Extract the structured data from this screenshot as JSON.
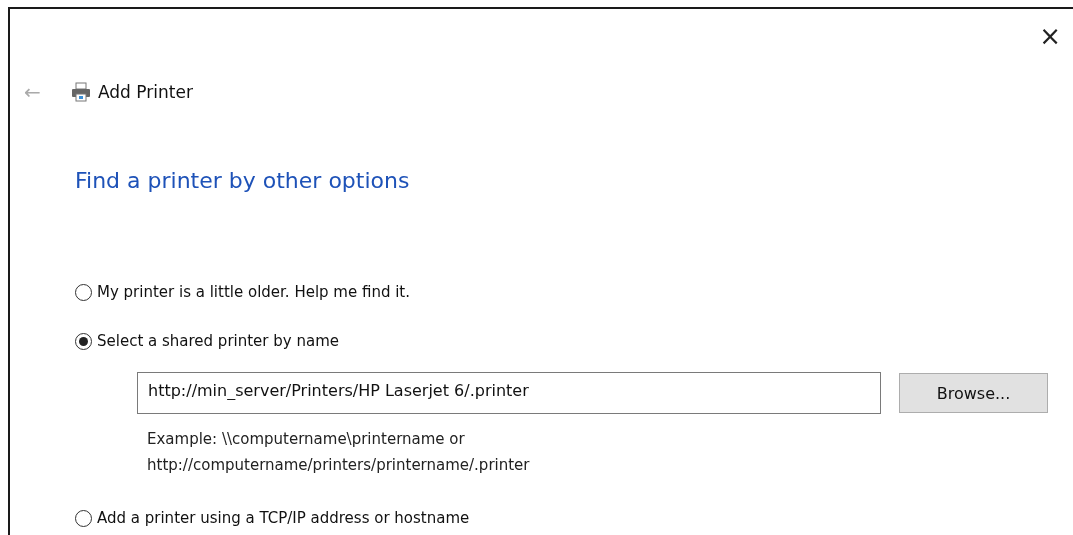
{
  "window": {
    "title": "Add Printer",
    "close": "×",
    "back": "←"
  },
  "heading": "Find a printer by other options",
  "options": [
    {
      "label": "My printer is a little older. Help me find it.",
      "selected": false
    },
    {
      "label": "Select a shared printer by name",
      "selected": true,
      "field": {
        "value": "http://min_server/Printers/HP Laserjet 6/.printer"
      },
      "button": "Browse...",
      "example": [
        "Example: \\\\computername\\printername or",
        "http://computername/printers/printername/.printer"
      ]
    },
    {
      "label": "Add a printer using a TCP/IP address or hostname",
      "selected": false
    }
  ]
}
